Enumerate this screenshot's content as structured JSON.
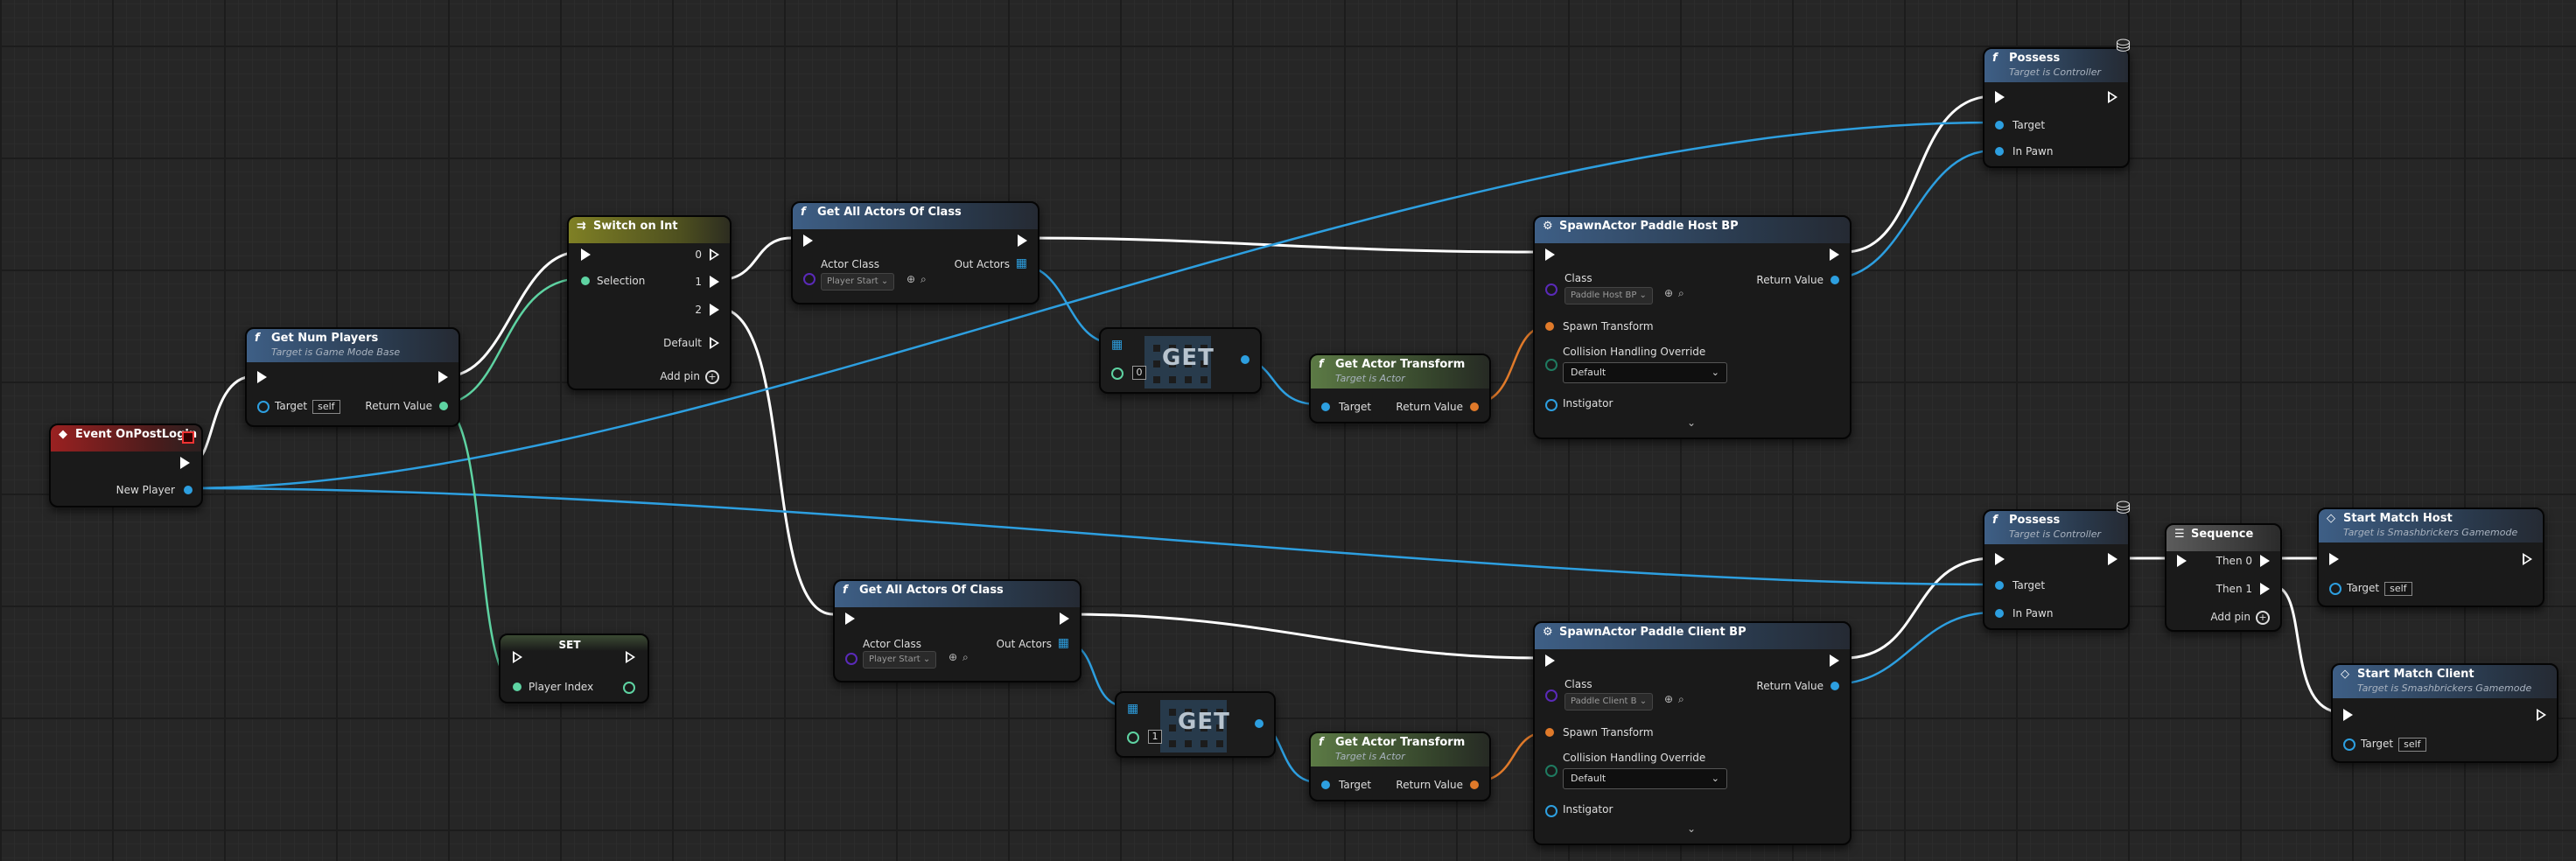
{
  "nodes": {
    "event_post_login": {
      "title": "Event OnPostLogin",
      "new_player": "New Player"
    },
    "get_num_players": {
      "title": "Get Num Players",
      "subtitle": "Target is Game Mode Base",
      "target": "Target",
      "self": "self",
      "return_value": "Return Value"
    },
    "switch_on_int": {
      "title": "Switch on Int",
      "selection": "Selection",
      "out0": "0",
      "out1": "1",
      "out2": "2",
      "default": "Default",
      "add_pin": "Add pin"
    },
    "set_node": {
      "title": "SET",
      "player_index": "Player Index"
    },
    "get_all_actors_1": {
      "title": "Get All Actors Of Class",
      "actor_class": "Actor Class",
      "out_actors": "Out Actors",
      "class_value": "Player Start"
    },
    "get_all_actors_2": {
      "title": "Get All Actors Of Class",
      "actor_class": "Actor Class",
      "out_actors": "Out Actors",
      "class_value": "Player Start"
    },
    "get_1": {
      "label": "GET",
      "index": "0"
    },
    "get_2": {
      "label": "GET",
      "index": "1"
    },
    "get_transform_1": {
      "title": "Get Actor Transform",
      "subtitle": "Target is Actor",
      "target": "Target",
      "return_value": "Return Value"
    },
    "get_transform_2": {
      "title": "Get Actor Transform",
      "subtitle": "Target is Actor",
      "target": "Target",
      "return_value": "Return Value"
    },
    "spawn_host": {
      "title": "SpawnActor Paddle Host BP",
      "class": "Class",
      "class_value": "Paddle Host BP",
      "return_value": "Return Value",
      "spawn_transform": "Spawn Transform",
      "collision": "Collision Handling Override",
      "collision_value": "Default",
      "instigator": "Instigator"
    },
    "spawn_client": {
      "title": "SpawnActor Paddle Client BP",
      "class": "Class",
      "class_value": "Paddle Client B",
      "return_value": "Return Value",
      "spawn_transform": "Spawn Transform",
      "collision": "Collision Handling Override",
      "collision_value": "Default",
      "instigator": "Instigator"
    },
    "possess_1": {
      "title": "Possess",
      "subtitle": "Target is Controller",
      "target": "Target",
      "in_pawn": "In Pawn"
    },
    "possess_2": {
      "title": "Possess",
      "subtitle": "Target is Controller",
      "target": "Target",
      "in_pawn": "In Pawn"
    },
    "sequence": {
      "title": "Sequence",
      "then0": "Then 0",
      "then1": "Then 1",
      "add_pin": "Add pin"
    },
    "start_host": {
      "title": "Start Match Host",
      "subtitle": "Target is Smashbrickers Gamemode",
      "target": "Target",
      "self": "self"
    },
    "start_client": {
      "title": "Start Match Client",
      "subtitle": "Target is Smashbrickers Gamemode",
      "target": "Target",
      "self": "self"
    }
  },
  "colors": {
    "exec_wire": "#ffffff",
    "object_wire": "#2d9fe0",
    "int_wire": "#5ed3a2",
    "transform_wire": "#e07a2a",
    "class_pin": "#5a2ab8"
  }
}
